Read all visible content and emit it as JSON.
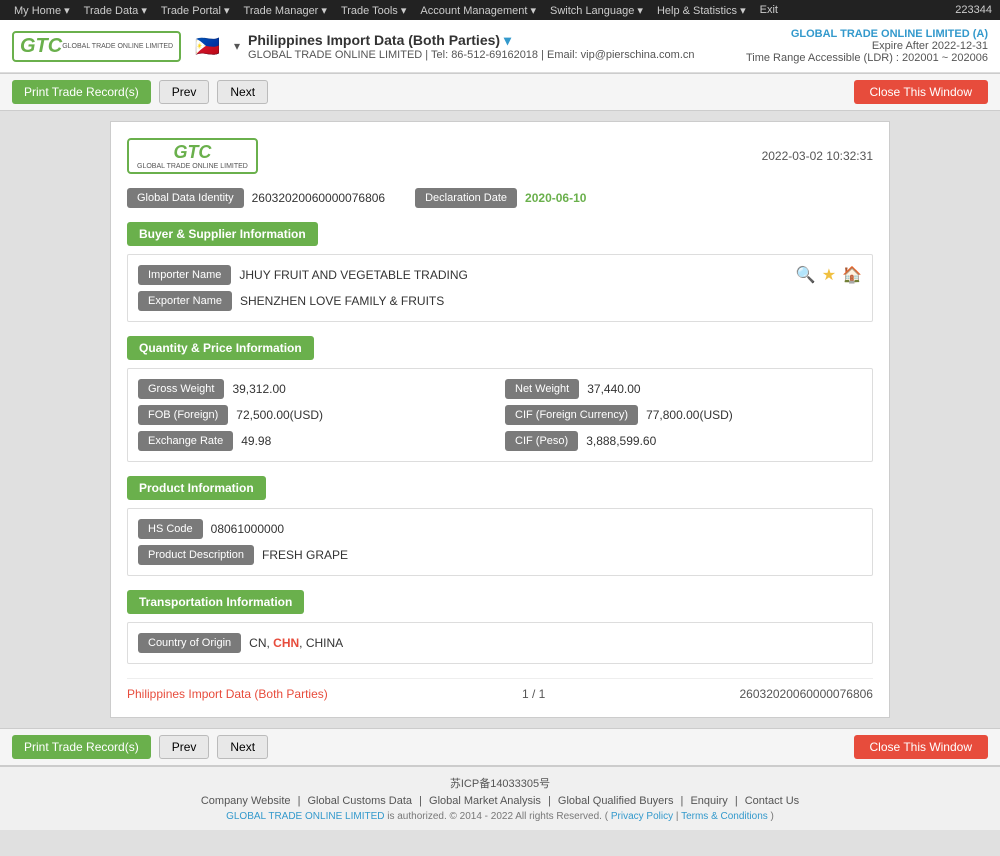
{
  "topbar": {
    "nav_items": [
      "My Home",
      "Trade Data",
      "Trade Portal",
      "Trade Manager",
      "Trade Tools",
      "Account Management",
      "Switch Language",
      "Help & Statistics",
      "Exit"
    ],
    "user_id": "223344"
  },
  "header": {
    "logo_text": "GTC",
    "logo_sub": "GLOBAL TRADE ONLINE LIMITED",
    "flag_emoji": "🇵🇭",
    "title": "Philippines Import Data (Both Parties)",
    "contact": "GLOBAL TRADE ONLINE LIMITED | Tel: 86-512-69162018 | Email: vip@pierschina.com.cn",
    "account_name": "GLOBAL TRADE ONLINE LIMITED (A)",
    "expire": "Expire After 2022-12-31",
    "time_range": "Time Range Accessible (LDR) : 202001 ~ 202006"
  },
  "toolbar": {
    "print_label": "Print Trade Record(s)",
    "prev_label": "Prev",
    "next_label": "Next",
    "close_label": "Close This Window"
  },
  "card": {
    "datetime": "2022-03-02 10:32:31",
    "logo_text": "GTC",
    "logo_sub": "GLOBAL TRADE ONLINE LIMITED",
    "global_data_identity_label": "Global Data Identity",
    "global_data_identity_value": "26032020060000076806",
    "declaration_date_label": "Declaration Date",
    "declaration_date_value": "2020-06-10",
    "sections": {
      "buyer_supplier": {
        "title": "Buyer & Supplier Information",
        "importer_label": "Importer Name",
        "importer_value": "JHUY FRUIT AND VEGETABLE TRADING",
        "exporter_label": "Exporter Name",
        "exporter_value": "SHENZHEN LOVE FAMILY & FRUITS"
      },
      "quantity_price": {
        "title": "Quantity & Price Information",
        "fields": [
          {
            "label": "Gross Weight",
            "value": "39,312.00",
            "label2": "Net Weight",
            "value2": "37,440.00"
          },
          {
            "label": "FOB (Foreign)",
            "value": "72,500.00(USD)",
            "label2": "CIF (Foreign Currency)",
            "value2": "77,800.00(USD)"
          },
          {
            "label": "Exchange Rate",
            "value": "49.98",
            "label2": "CIF (Peso)",
            "value2": "3,888,599.60"
          }
        ]
      },
      "product": {
        "title": "Product Information",
        "hs_label": "HS Code",
        "hs_value": "08061000000",
        "desc_label": "Product Description",
        "desc_value": "FRESH GRAPE"
      },
      "transportation": {
        "title": "Transportation Information",
        "country_label": "Country of Origin",
        "country_value": "CN, CHN, CHINA",
        "country_highlight": "CHN"
      }
    },
    "footer": {
      "link_text": "Philippines Import Data (Both Parties)",
      "page": "1 / 1",
      "record_id": "26032020060000076806"
    }
  },
  "bottom_toolbar": {
    "print_label": "Print Trade Record(s)",
    "prev_label": "Prev",
    "next_label": "Next",
    "close_label": "Close This Window"
  },
  "footer": {
    "icp": "苏ICP备14033305号",
    "links": [
      "Company Website",
      "Global Customs Data",
      "Global Market Analysis",
      "Global Qualified Buyers",
      "Enquiry",
      "Contact Us"
    ],
    "copy": "GLOBAL TRADE ONLINE LIMITED is authorized. © 2014 - 2022 All rights Reserved.",
    "privacy": "Privacy Policy",
    "terms": "Terms & Conditions"
  }
}
